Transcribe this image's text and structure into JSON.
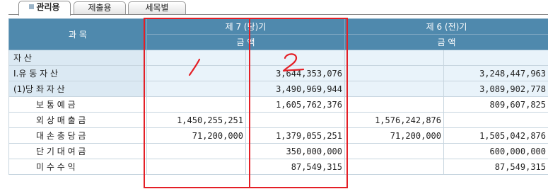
{
  "tabs": [
    {
      "label": "관리용",
      "active": true
    },
    {
      "label": "제출용",
      "active": false
    },
    {
      "label": "세목별",
      "active": false
    }
  ],
  "header": {
    "subject": "과  목",
    "period_current": "제 7 (당)기",
    "period_prior": "제 6 (전)기",
    "amount_current": "금        액",
    "amount_prior": "금        액"
  },
  "rows": [
    {
      "label": "자          산",
      "c1": "",
      "c2": "",
      "p1": "",
      "p2": "",
      "band": true
    },
    {
      "label": "Ⅰ.유  동   자  산",
      "c1": "",
      "c2": "3,644,353,076",
      "p1": "",
      "p2": "3,248,447,963",
      "band": true
    },
    {
      "label": "(1)당  좌   자  산",
      "c1": "",
      "c2": "3,490,969,944",
      "p1": "",
      "p2": "3,089,902,778",
      "band": true
    },
    {
      "label": "보  통  예  금",
      "c1": "",
      "c2": "1,605,762,376",
      "p1": "",
      "p2": "809,607,825",
      "band": false
    },
    {
      "label": "외 상 매 출 금",
      "c1": "1,450,255,251",
      "c2": "",
      "p1": "1,576,242,876",
      "p2": "",
      "band": false
    },
    {
      "label": "대 손 충 당 금",
      "c1": "71,200,000",
      "c2": "1,379,055,251",
      "p1": "71,200,000",
      "p2": "1,505,042,876",
      "band": false
    },
    {
      "label": "단 기 대 여 금",
      "c1": "",
      "c2": "350,000,000",
      "p1": "",
      "p2": "600,000,000",
      "band": false
    },
    {
      "label": "미   수   수   익",
      "c1": "",
      "c2": "87,549,315",
      "p1": "",
      "p2": "87,549,315",
      "band": false
    }
  ],
  "annotations": {
    "mark1": "1",
    "mark2": "2",
    "color": "#e41f26"
  },
  "colors": {
    "header_bg": "#4f89ad",
    "band_bg": "#dbe9f3",
    "grid": "#c7d5df"
  }
}
